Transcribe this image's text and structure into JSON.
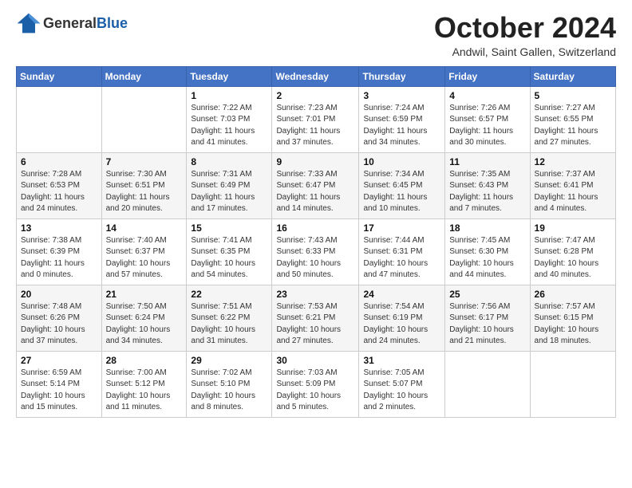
{
  "header": {
    "logo": {
      "general": "General",
      "blue": "Blue"
    },
    "title": "October 2024",
    "location": "Andwil, Saint Gallen, Switzerland"
  },
  "days_of_week": [
    "Sunday",
    "Monday",
    "Tuesday",
    "Wednesday",
    "Thursday",
    "Friday",
    "Saturday"
  ],
  "weeks": [
    [
      {
        "day": "",
        "info": ""
      },
      {
        "day": "",
        "info": ""
      },
      {
        "day": "1",
        "info": "Sunrise: 7:22 AM\nSunset: 7:03 PM\nDaylight: 11 hours and 41 minutes."
      },
      {
        "day": "2",
        "info": "Sunrise: 7:23 AM\nSunset: 7:01 PM\nDaylight: 11 hours and 37 minutes."
      },
      {
        "day": "3",
        "info": "Sunrise: 7:24 AM\nSunset: 6:59 PM\nDaylight: 11 hours and 34 minutes."
      },
      {
        "day": "4",
        "info": "Sunrise: 7:26 AM\nSunset: 6:57 PM\nDaylight: 11 hours and 30 minutes."
      },
      {
        "day": "5",
        "info": "Sunrise: 7:27 AM\nSunset: 6:55 PM\nDaylight: 11 hours and 27 minutes."
      }
    ],
    [
      {
        "day": "6",
        "info": "Sunrise: 7:28 AM\nSunset: 6:53 PM\nDaylight: 11 hours and 24 minutes."
      },
      {
        "day": "7",
        "info": "Sunrise: 7:30 AM\nSunset: 6:51 PM\nDaylight: 11 hours and 20 minutes."
      },
      {
        "day": "8",
        "info": "Sunrise: 7:31 AM\nSunset: 6:49 PM\nDaylight: 11 hours and 17 minutes."
      },
      {
        "day": "9",
        "info": "Sunrise: 7:33 AM\nSunset: 6:47 PM\nDaylight: 11 hours and 14 minutes."
      },
      {
        "day": "10",
        "info": "Sunrise: 7:34 AM\nSunset: 6:45 PM\nDaylight: 11 hours and 10 minutes."
      },
      {
        "day": "11",
        "info": "Sunrise: 7:35 AM\nSunset: 6:43 PM\nDaylight: 11 hours and 7 minutes."
      },
      {
        "day": "12",
        "info": "Sunrise: 7:37 AM\nSunset: 6:41 PM\nDaylight: 11 hours and 4 minutes."
      }
    ],
    [
      {
        "day": "13",
        "info": "Sunrise: 7:38 AM\nSunset: 6:39 PM\nDaylight: 11 hours and 0 minutes."
      },
      {
        "day": "14",
        "info": "Sunrise: 7:40 AM\nSunset: 6:37 PM\nDaylight: 10 hours and 57 minutes."
      },
      {
        "day": "15",
        "info": "Sunrise: 7:41 AM\nSunset: 6:35 PM\nDaylight: 10 hours and 54 minutes."
      },
      {
        "day": "16",
        "info": "Sunrise: 7:43 AM\nSunset: 6:33 PM\nDaylight: 10 hours and 50 minutes."
      },
      {
        "day": "17",
        "info": "Sunrise: 7:44 AM\nSunset: 6:31 PM\nDaylight: 10 hours and 47 minutes."
      },
      {
        "day": "18",
        "info": "Sunrise: 7:45 AM\nSunset: 6:30 PM\nDaylight: 10 hours and 44 minutes."
      },
      {
        "day": "19",
        "info": "Sunrise: 7:47 AM\nSunset: 6:28 PM\nDaylight: 10 hours and 40 minutes."
      }
    ],
    [
      {
        "day": "20",
        "info": "Sunrise: 7:48 AM\nSunset: 6:26 PM\nDaylight: 10 hours and 37 minutes."
      },
      {
        "day": "21",
        "info": "Sunrise: 7:50 AM\nSunset: 6:24 PM\nDaylight: 10 hours and 34 minutes."
      },
      {
        "day": "22",
        "info": "Sunrise: 7:51 AM\nSunset: 6:22 PM\nDaylight: 10 hours and 31 minutes."
      },
      {
        "day": "23",
        "info": "Sunrise: 7:53 AM\nSunset: 6:21 PM\nDaylight: 10 hours and 27 minutes."
      },
      {
        "day": "24",
        "info": "Sunrise: 7:54 AM\nSunset: 6:19 PM\nDaylight: 10 hours and 24 minutes."
      },
      {
        "day": "25",
        "info": "Sunrise: 7:56 AM\nSunset: 6:17 PM\nDaylight: 10 hours and 21 minutes."
      },
      {
        "day": "26",
        "info": "Sunrise: 7:57 AM\nSunset: 6:15 PM\nDaylight: 10 hours and 18 minutes."
      }
    ],
    [
      {
        "day": "27",
        "info": "Sunrise: 6:59 AM\nSunset: 5:14 PM\nDaylight: 10 hours and 15 minutes."
      },
      {
        "day": "28",
        "info": "Sunrise: 7:00 AM\nSunset: 5:12 PM\nDaylight: 10 hours and 11 minutes."
      },
      {
        "day": "29",
        "info": "Sunrise: 7:02 AM\nSunset: 5:10 PM\nDaylight: 10 hours and 8 minutes."
      },
      {
        "day": "30",
        "info": "Sunrise: 7:03 AM\nSunset: 5:09 PM\nDaylight: 10 hours and 5 minutes."
      },
      {
        "day": "31",
        "info": "Sunrise: 7:05 AM\nSunset: 5:07 PM\nDaylight: 10 hours and 2 minutes."
      },
      {
        "day": "",
        "info": ""
      },
      {
        "day": "",
        "info": ""
      }
    ]
  ]
}
